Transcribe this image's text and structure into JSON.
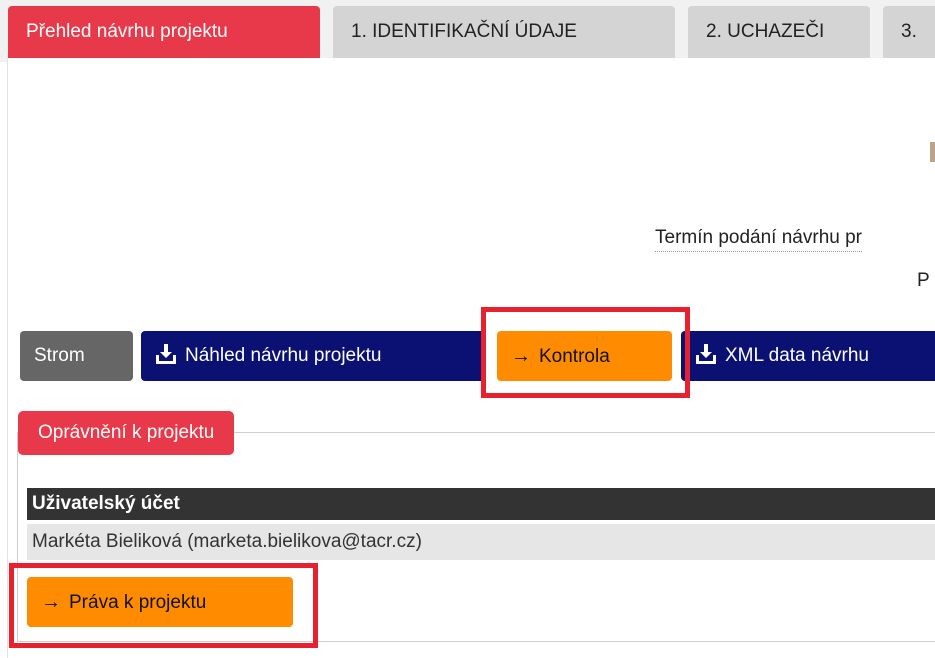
{
  "tabs": [
    {
      "label": "Přehled návrhu projektu",
      "active": true
    },
    {
      "label": "1. IDENTIFIKAČNÍ ÚDAJE",
      "active": false
    },
    {
      "label": "2. UCHAZEČI",
      "active": false
    },
    {
      "label": "3.",
      "active": false
    }
  ],
  "info": {
    "deadline_label": "Termín podání návrhu pr",
    "fragment_p": "P"
  },
  "toolbar": {
    "strom": "Strom",
    "nahled": "Náhled návrhu projektu",
    "kontrola": "Kontrola",
    "xml": "XML data návrhu"
  },
  "permissions": {
    "legend": "Oprávnění k projektu",
    "column_header": "Uživatelský účet",
    "rows": [
      "Markéta Bieliková (marketa.bielikova@tacr.cz)"
    ],
    "rights_button": "Práva k projektu"
  },
  "icons": {
    "download": "download-tray-icon",
    "arrow": "arrow-right-icon"
  },
  "colors": {
    "accent_red": "#e8394a",
    "navy": "#0a1172",
    "orange": "#ff8c00",
    "highlight_red": "#e8212e"
  }
}
